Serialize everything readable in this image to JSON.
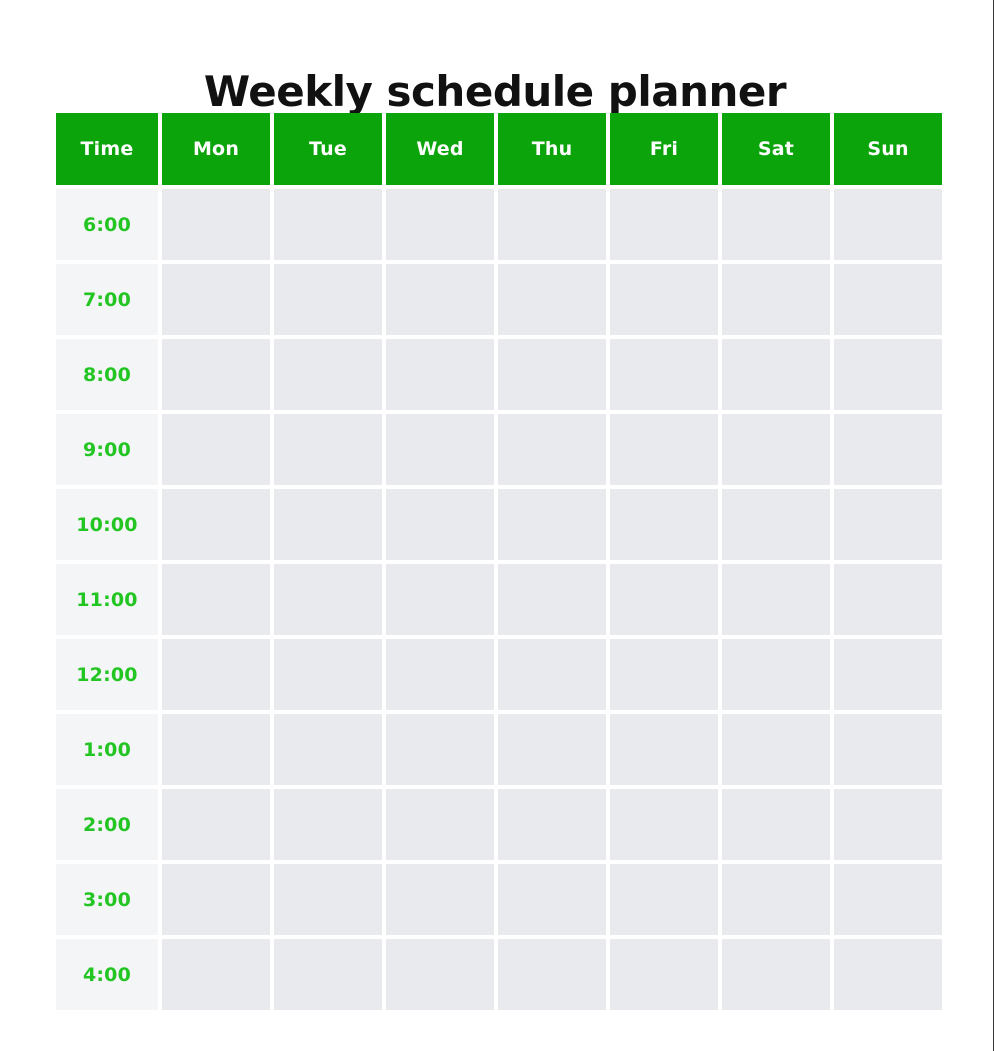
{
  "page": {
    "title": "Weekly schedule planner",
    "background_color": "#ffffff"
  },
  "colors": {
    "header_background": "#0ba40b",
    "header_text": "#ffffff",
    "time_label_text": "#22c522",
    "time_cell_background": "#f4f5f7",
    "day_cell_background": "#e8eaed",
    "title_text": "#111111"
  },
  "table": {
    "columns": [
      {
        "key": "time",
        "label": "Time"
      },
      {
        "key": "mon",
        "label": "Mon"
      },
      {
        "key": "tue",
        "label": "Tue"
      },
      {
        "key": "wed",
        "label": "Wed"
      },
      {
        "key": "thu",
        "label": "Thu"
      },
      {
        "key": "fri",
        "label": "Fri"
      },
      {
        "key": "sat",
        "label": "Sat"
      },
      {
        "key": "sun",
        "label": "Sun"
      }
    ],
    "rows": [
      {
        "time": "6:00",
        "mon": "",
        "tue": "",
        "wed": "",
        "thu": "",
        "fri": "",
        "sat": "",
        "sun": ""
      },
      {
        "time": "7:00",
        "mon": "",
        "tue": "",
        "wed": "",
        "thu": "",
        "fri": "",
        "sat": "",
        "sun": ""
      },
      {
        "time": "8:00",
        "mon": "",
        "tue": "",
        "wed": "",
        "thu": "",
        "fri": "",
        "sat": "",
        "sun": ""
      },
      {
        "time": "9:00",
        "mon": "",
        "tue": "",
        "wed": "",
        "thu": "",
        "fri": "",
        "sat": "",
        "sun": ""
      },
      {
        "time": "10:00",
        "mon": "",
        "tue": "",
        "wed": "",
        "thu": "",
        "fri": "",
        "sat": "",
        "sun": ""
      },
      {
        "time": "11:00",
        "mon": "",
        "tue": "",
        "wed": "",
        "thu": "",
        "fri": "",
        "sat": "",
        "sun": ""
      },
      {
        "time": "12:00",
        "mon": "",
        "tue": "",
        "wed": "",
        "thu": "",
        "fri": "",
        "sat": "",
        "sun": ""
      },
      {
        "time": "1:00",
        "mon": "",
        "tue": "",
        "wed": "",
        "thu": "",
        "fri": "",
        "sat": "",
        "sun": ""
      },
      {
        "time": "2:00",
        "mon": "",
        "tue": "",
        "wed": "",
        "thu": "",
        "fri": "",
        "sat": "",
        "sun": ""
      },
      {
        "time": "3:00",
        "mon": "",
        "tue": "",
        "wed": "",
        "thu": "",
        "fri": "",
        "sat": "",
        "sun": ""
      },
      {
        "time": "4:00",
        "mon": "",
        "tue": "",
        "wed": "",
        "thu": "",
        "fri": "",
        "sat": "",
        "sun": ""
      }
    ]
  }
}
